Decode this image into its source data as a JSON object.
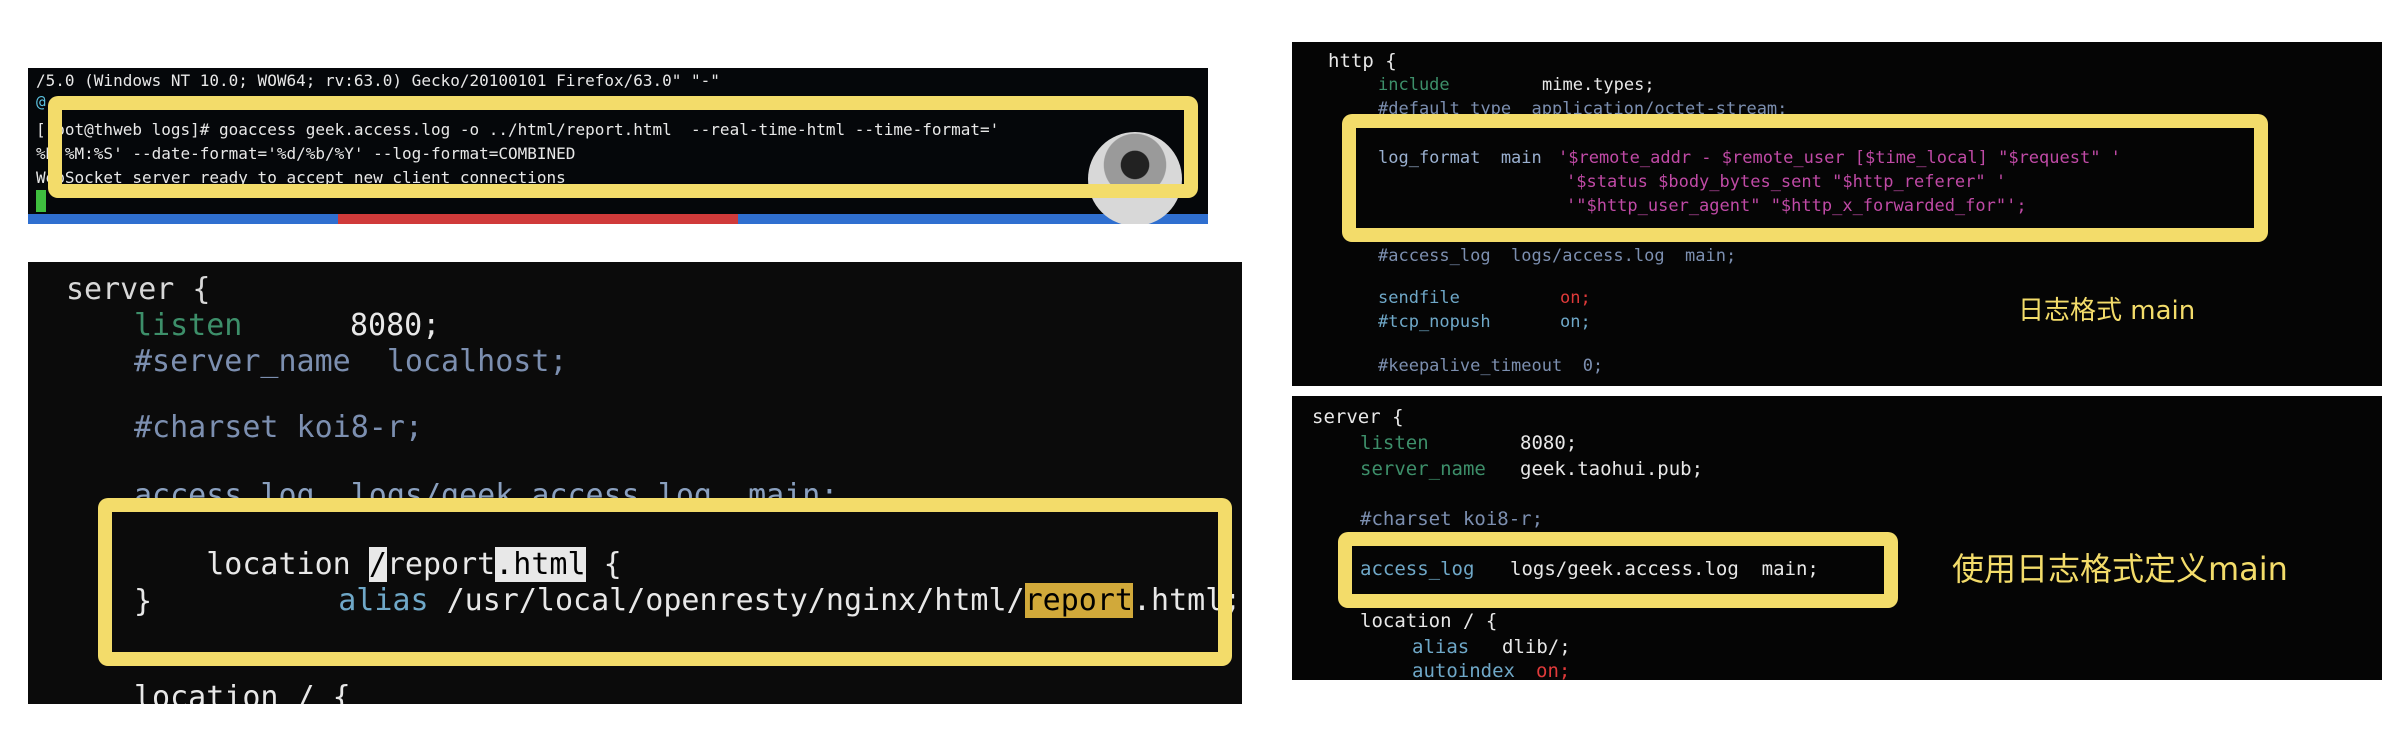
{
  "terminal": {
    "line1": "/5.0 (Windows NT 10.0; WOW64; rv:63.0) Gecko/20100101 Firefox/63.0\" \"-\"",
    "line2": "@",
    "line3": "[root@thweb logs]# goaccess geek.access.log -o ../html/report.html  --real-time-html --time-format='",
    "line4": "%H:%M:%S' --date-format='%d/%b/%Y' --log-format=COMBINED",
    "line5": "WebSocket server ready to accept new client connections"
  },
  "server_left": {
    "l1": "server {",
    "l2_kw": "listen",
    "l2_val": "8080;",
    "l3": "#server_name  localhost;",
    "l4": "#charset koi8-r;",
    "l5": "access_log  logs/geek.access.log  main;",
    "l6_a": "location ",
    "l6_b": "/",
    "l6_c": "report",
    "l6_d": ".html",
    "l6_e": " {",
    "l7_kw": "alias",
    "l7_a": " /usr/local/openresty/nginx/html/",
    "l7_b": "report",
    "l7_c": ".html;",
    "l8": "}",
    "l9": "location / {"
  },
  "http_right": {
    "l1": "http {",
    "l2_kw": "include",
    "l2_val": "mime.types;",
    "l3": "#default_type  application/octet-stream;",
    "l4_kw": "log_format  main",
    "l4_val": "'$remote_addr - $remote_user [$time_local] \"$request\" '",
    "l5_val": "'$status $body_bytes_sent \"$http_referer\" '",
    "l6_val": "'\"$http_user_agent\" \"$http_x_forwarded_for\"';",
    "l7": "#access_log  logs/access.log  main;",
    "l8_kw": "sendfile",
    "l8_val": "on;",
    "l9_kw": "#tcp_nopush",
    "l9_val": "on;",
    "l10": "#keepalive_timeout  0;",
    "caption": "日志格式 main"
  },
  "server_right": {
    "l1": "server {",
    "l2_kw": "listen",
    "l2_val": "8080;",
    "l3_kw": "server_name",
    "l3_val": "geek.taohui.pub;",
    "l4": "#charset koi8-r;",
    "l5_kw": "access_log",
    "l5_val": "logs/geek.access.log  main;",
    "l6": "location / {",
    "l7_kw": "alias",
    "l7_val": "dlib/;",
    "l8_kw": "autoindex",
    "l8_val": "on;",
    "caption": "使用日志格式定义main"
  },
  "colors": {
    "highlight_box": "#f3dc6a",
    "panel_bg": "#000000",
    "keyword": "#3d8f6a",
    "string": "#c04aa6"
  }
}
